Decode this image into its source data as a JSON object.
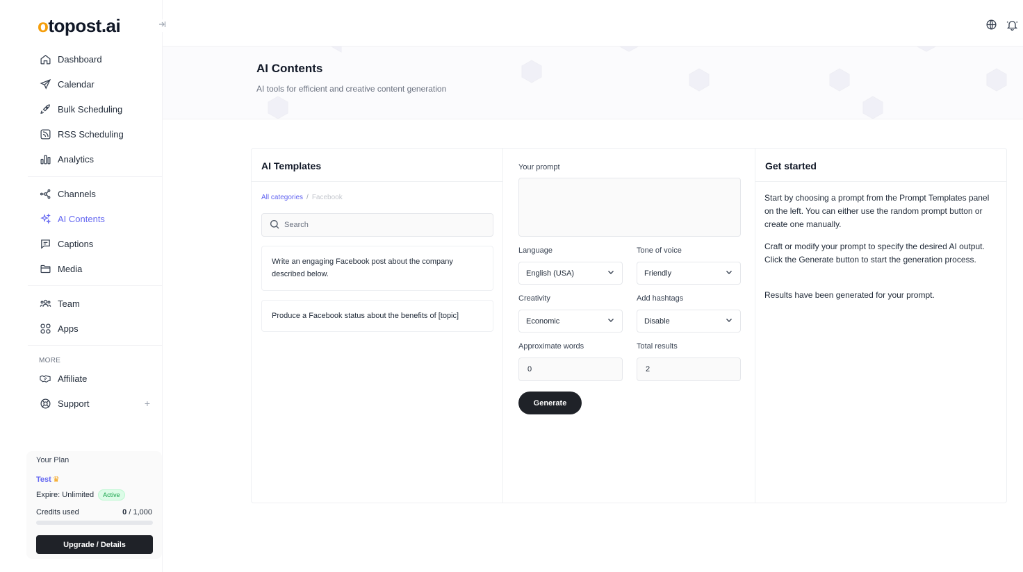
{
  "brand": {
    "logo_o": "o",
    "logo_rest": "topost.ai",
    "accent": "#6366f1",
    "logo_color": "#f59e0b"
  },
  "sidebar": {
    "items": [
      {
        "label": "Dashboard",
        "icon": "home-icon"
      },
      {
        "label": "Calendar",
        "icon": "send-icon"
      },
      {
        "label": "Bulk Scheduling",
        "icon": "rocket-icon"
      },
      {
        "label": "RSS Scheduling",
        "icon": "rss-icon"
      },
      {
        "label": "Analytics",
        "icon": "bar-chart-icon"
      },
      {
        "label": "Channels",
        "icon": "network-icon"
      },
      {
        "label": "AI Contents",
        "icon": "sparkles-icon"
      },
      {
        "label": "Captions",
        "icon": "message-square-icon"
      },
      {
        "label": "Media",
        "icon": "folder-icon"
      },
      {
        "label": "Team",
        "icon": "users-icon"
      },
      {
        "label": "Apps",
        "icon": "grid-icon"
      },
      {
        "label": "Affiliate",
        "icon": "handshake-icon"
      },
      {
        "label": "Support",
        "icon": "lifebuoy-icon"
      }
    ],
    "more_label": "MORE",
    "support_plus": "+"
  },
  "plan": {
    "title": "Your Plan",
    "name": "Test",
    "expire_label": "Expire: Unlimited",
    "status": "Active",
    "credits_label": "Credits used",
    "credits_used": "0",
    "credits_total": " / 1,000",
    "credits_fraction": 0,
    "upgrade_label": "Upgrade / Details"
  },
  "header": {
    "title": "AI Contents",
    "subtitle": "AI tools for efficient and creative content generation"
  },
  "templates": {
    "title": "AI Templates",
    "crumb_all": "All categories",
    "crumb_sep": "/",
    "crumb_current": "Facebook",
    "search_placeholder": "Search",
    "items": [
      "Write an engaging Facebook post about the company described below.",
      "Produce a Facebook status about the benefits of [topic]"
    ]
  },
  "form": {
    "prompt_label": "Your prompt",
    "prompt_value": "",
    "language_label": "Language",
    "language_value": "English (USA)",
    "tone_label": "Tone of voice",
    "tone_value": "Friendly",
    "creativity_label": "Creativity",
    "creativity_value": "Economic",
    "hashtags_label": "Add hashtags",
    "hashtags_value": "Disable",
    "words_label": "Approximate words",
    "words_value": "0",
    "results_label": "Total results",
    "results_value": "2",
    "generate_label": "Generate"
  },
  "guide": {
    "title": "Get started",
    "paragraphs": [
      "Start by choosing a prompt from the Prompt Templates panel on the left. You can either use the random prompt button or create one manually.",
      "Craft or modify your prompt to specify the desired AI output. Click the Generate button to start the generation process.",
      "Results have been generated for your prompt."
    ]
  }
}
